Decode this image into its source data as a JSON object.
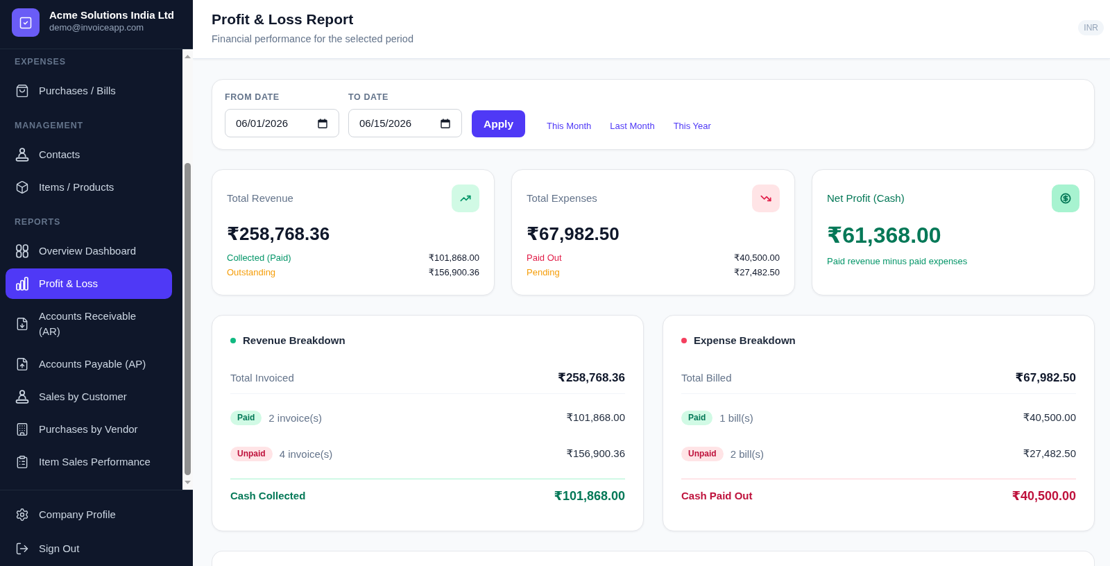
{
  "sidebar": {
    "company": {
      "name": "Acme Solutions India Ltd",
      "email": "demo@invoiceapp.com"
    },
    "sections": [
      {
        "heading": "EXPENSES",
        "items": [
          {
            "label": "Purchases / Bills",
            "selected": false
          }
        ]
      },
      {
        "heading": "MANAGEMENT",
        "items": [
          {
            "label": "Contacts",
            "selected": false
          },
          {
            "label": "Items / Products",
            "selected": false
          }
        ]
      },
      {
        "heading": "REPORTS",
        "items": [
          {
            "label": "Overview Dashboard",
            "selected": false
          },
          {
            "label": "Profit & Loss",
            "selected": true
          },
          {
            "label": "Accounts Receivable (AR)",
            "selected": false
          },
          {
            "label": "Accounts Payable (AP)",
            "selected": false
          },
          {
            "label": "Sales by Customer",
            "selected": false
          },
          {
            "label": "Purchases by Vendor",
            "selected": false
          },
          {
            "label": "Item Sales Performance",
            "selected": false
          }
        ]
      }
    ],
    "footer_items": [
      {
        "label": "Company Profile"
      },
      {
        "label": "Sign Out"
      }
    ]
  },
  "header": {
    "title": "Profit & Loss Report",
    "subtitle": "Financial performance for the selected period",
    "currency": "INR"
  },
  "filters": {
    "fields": [
      {
        "label": "FROM DATE",
        "value": "06/01/2026"
      },
      {
        "label": "TO DATE",
        "value": "06/15/2026"
      }
    ],
    "apply_button": "Apply",
    "presets": [
      "This Month",
      "Last Month",
      "This Year"
    ]
  },
  "stats": [
    {
      "kind": "metric",
      "title": "Total Revenue",
      "value": "₹258,768.36",
      "rows": [
        {
          "label": "Collected (Paid)",
          "color": "#059669",
          "value": "₹101,868.00"
        },
        {
          "label": "Outstanding",
          "color": "#f59e0b",
          "value": "₹156,900.36"
        }
      ]
    },
    {
      "kind": "metric",
      "title": "Total Expenses",
      "value": "₹67,982.50",
      "rows": [
        {
          "label": "Paid Out",
          "color": "#e11d48",
          "value": "₹40,500.00"
        },
        {
          "label": "Pending",
          "color": "#f59e0b",
          "value": "₹27,482.50"
        }
      ]
    },
    {
      "kind": "highlight",
      "title": "Net Profit (Cash)",
      "value": "₹61,368.00",
      "note": "Paid revenue minus paid expenses"
    }
  ],
  "breakdowns": [
    {
      "kind": "revenue",
      "title": "Revenue Breakdown",
      "color": "#10b981",
      "total": {
        "label": "Total Invoiced",
        "value": "₹258,768.36"
      },
      "lines": [
        {
          "status": "Paid",
          "paid": true,
          "count": "2 invoice(s)",
          "value": "₹101,868.00"
        },
        {
          "status": "Unpaid",
          "paid": false,
          "count": "4 invoice(s)",
          "value": "₹156,900.36"
        }
      ],
      "net": {
        "label": "Cash Collected",
        "value": "₹101,868.00"
      }
    },
    {
      "kind": "expense",
      "title": "Expense Breakdown",
      "color": "#f43f5e",
      "total": {
        "label": "Total Billed",
        "value": "₹67,982.50"
      },
      "lines": [
        {
          "status": "Paid",
          "paid": true,
          "count": "1 bill(s)",
          "value": "₹40,500.00"
        },
        {
          "status": "Unpaid",
          "paid": false,
          "count": "2 bill(s)",
          "value": "₹27,482.50"
        }
      ],
      "net": {
        "label": "Cash Paid Out",
        "value": "₹40,500.00"
      }
    }
  ]
}
